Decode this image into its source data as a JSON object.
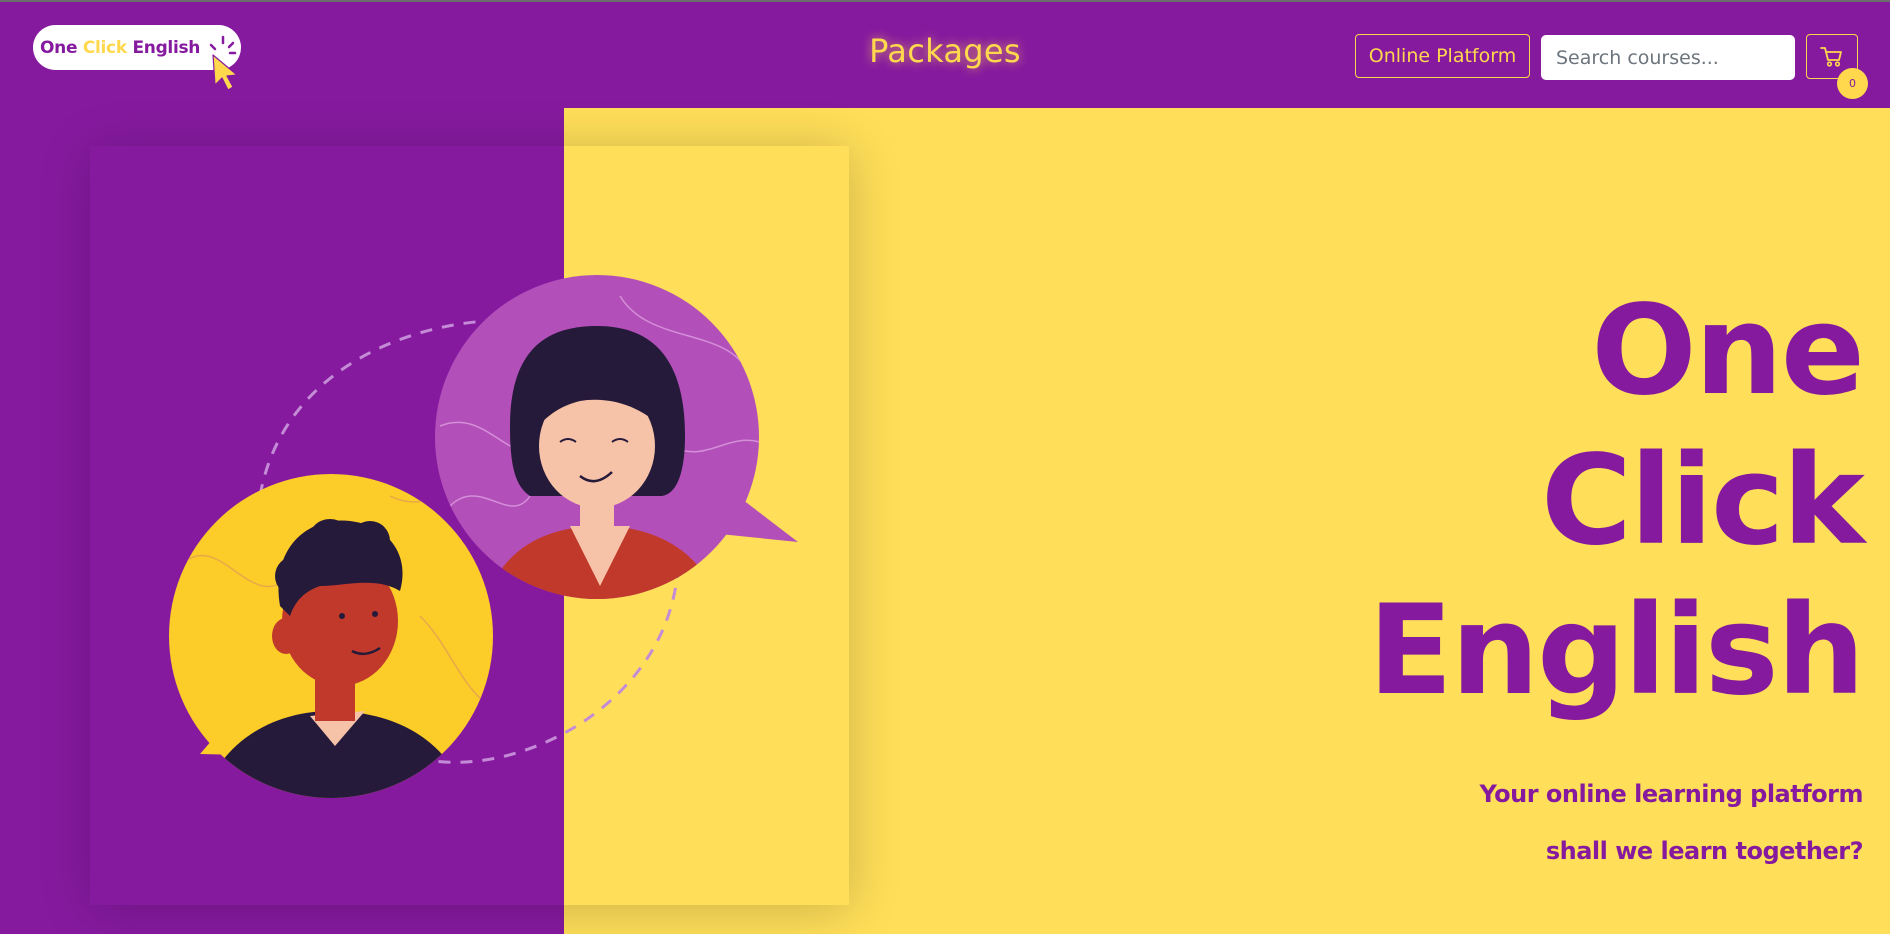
{
  "header": {
    "logo": {
      "word1": "One",
      "word2": "Click",
      "word3": "English"
    },
    "nav_title": "Packages",
    "platform_button_label": "Online Platform",
    "search": {
      "placeholder": "Search courses...",
      "value": ""
    },
    "cart": {
      "count": "0"
    }
  },
  "hero": {
    "title_lines": [
      "One",
      "Click",
      "English"
    ],
    "subtitle_1": "Your online learning platform",
    "subtitle_2": "shall we learn together?"
  },
  "colors": {
    "brand_purple": "#861a9f",
    "brand_yellow": "#ffde59",
    "accent_yellow": "#ffd84d"
  },
  "icons": {
    "cart": "shopping-cart-icon",
    "logo_cursor": "cursor-click-icon"
  }
}
